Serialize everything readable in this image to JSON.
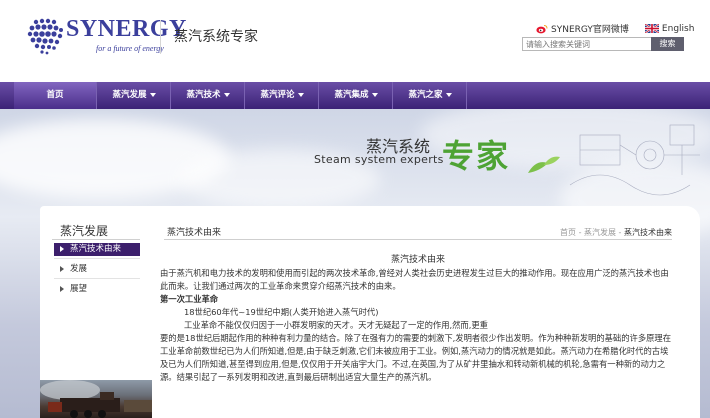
{
  "header": {
    "logo_text": "SYNERGY",
    "logo_tagline": "for a future of energy",
    "slogan": "蒸汽系统专家",
    "weibo_link": "SYNERGY官网微博",
    "english_link": "English",
    "search_placeholder": "请输入搜索关键词",
    "search_button": "搜索"
  },
  "nav": {
    "items": [
      {
        "label": "首页"
      },
      {
        "label": "蒸汽发展"
      },
      {
        "label": "蒸汽技术"
      },
      {
        "label": "蒸汽评论"
      },
      {
        "label": "蒸汽集成"
      },
      {
        "label": "蒸汽之家"
      }
    ]
  },
  "banner": {
    "title_cn": "蒸汽系统",
    "title_en": "Steam system experts",
    "title_big": "专家"
  },
  "sidebar": {
    "title": "蒸汽发展",
    "items": [
      {
        "label": "蒸汽技术由来"
      },
      {
        "label": "发展"
      },
      {
        "label": "展望"
      }
    ]
  },
  "main": {
    "title": "蒸汽技术由来",
    "breadcrumb": {
      "home": "首页",
      "sep1": " - ",
      "level1": "蒸汽发展",
      "sep2": " - ",
      "current": "蒸汽技术由来"
    },
    "article": {
      "title": "蒸汽技术由来",
      "p1": "由于蒸汽机和电力技术的发明和使用而引起的两次技术革命,曾经对人类社会历史进程发生过巨大的推动作用。现在应用广泛的蒸汽技术也由此而来。让我们通过两次的工业革命来贯穿介绍蒸汽技术的由来。",
      "section1": "第一次工业革命",
      "p2": "18世纪60年代~19世纪中期(人类开始进入蒸气时代)",
      "p3": "工业革命不能仅仅归因于一小群发明家的天才。天才无疑起了一定的作用,然而,更重",
      "p4": "要的是18世纪后期起作用的种种有利力量的结合。除了在强有力的需要的刺激下,发明者很少作出发明。作为种种新发明的基础的许多原理在工业革命前数世纪已为人们所知道,但是,由于缺乏刺激,它们未被应用于工业。例如,蒸汽动力的情况就是如此。蒸汽动力在希腊化时代的古埃及已为人们所知道,甚至得到应用,但是,仅仅用于开关庙宇大门。不过,在英国,为了从矿井里抽水和转动新机械的机轮,急需有一种新的动力之源。结果引起了一系列发明和改进,直到最后研制出适宜大量生产的蒸汽机。"
    }
  }
}
